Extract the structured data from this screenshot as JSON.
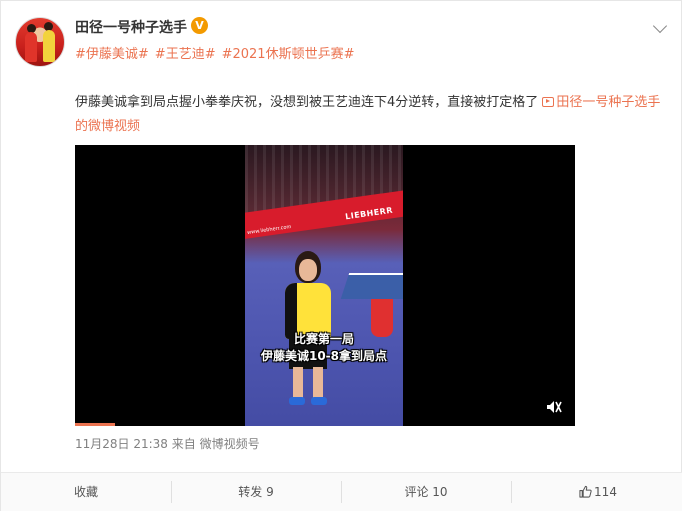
{
  "post": {
    "username": "田径一号种子选手",
    "verified_badge": "V",
    "tags": [
      "#伊藤美诚#",
      "#王艺迪#",
      "#2021休斯顿世乒赛#"
    ],
    "text": "伊藤美诚拿到局点握小拳拳庆祝，没想到被王艺迪连下4分逆转，直接被打定格了",
    "video_link": "田径一号种子选手的微博视频",
    "video": {
      "banner_brand": "LIEBHERR",
      "banner_url": "www.liebherr.com",
      "caption_line1": "比赛第一局",
      "caption_line2": "伊藤美诚10-8拿到局点",
      "progress_fraction": 0.08
    },
    "meta": {
      "time": "11月28日 21:38",
      "source_prefix": "来自",
      "source": "微博视频号"
    }
  },
  "actions": {
    "favorite_label": "收藏",
    "repost_label": "转发 9",
    "comment_label": "评论 10",
    "like_count": "114"
  },
  "colors": {
    "accent": "#eb7350",
    "verified": "#f39a00",
    "text": "#333333",
    "muted": "#808080"
  }
}
